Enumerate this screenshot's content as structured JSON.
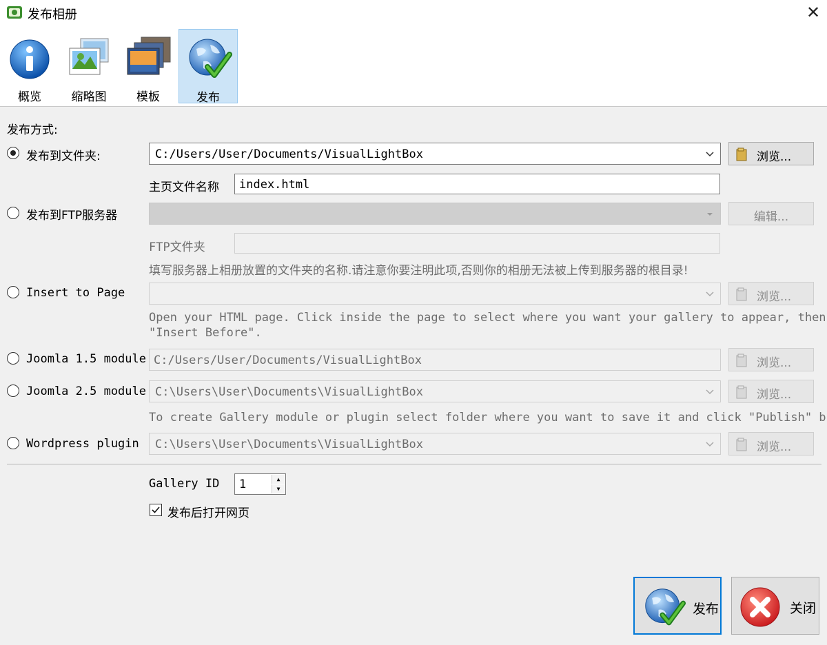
{
  "window": {
    "title": "发布相册",
    "close_glyph": "✕"
  },
  "tabs": [
    {
      "label": "概览",
      "icon": "info-icon"
    },
    {
      "label": "缩略图",
      "icon": "thumbnails-icon"
    },
    {
      "label": "模板",
      "icon": "templates-icon"
    },
    {
      "label": "发布",
      "icon": "globe-check-icon",
      "active": true
    }
  ],
  "publish": {
    "method_label": "发布方式:",
    "folder": {
      "label": "发布到文件夹:",
      "path": "C:/Users/User/Documents/VisualLightBox",
      "browse": "浏览...",
      "selected": true
    },
    "homepage": {
      "label": "主页文件名称",
      "value": "index.html"
    },
    "ftp": {
      "label": "发布到FTP服务器",
      "server": "",
      "edit": "编辑...",
      "folder_label": "FTP文件夹",
      "folder_value": "",
      "hint": "填写服务器上相册放置的文件夹的名称.请注意你要注明此项,否则你的相册无法被上传到服务器的根目录!"
    },
    "insert": {
      "label": "Insert to Page",
      "path": "",
      "browse": "浏览...",
      "hint_line1": "Open your HTML page. Click inside the page to select where you want your gallery to appear, then click",
      "hint_line2": "\"Insert Before\"."
    },
    "joomla15": {
      "label": "Joomla 1.5 module",
      "path": "C:/Users/User/Documents/VisualLightBox",
      "browse": "浏览..."
    },
    "joomla25": {
      "label": "Joomla 2.5 module",
      "path": "C:\\Users\\User\\Documents\\VisualLightBox",
      "browse": "浏览...",
      "hint": "To create Gallery module or plugin select folder where you want to save it and click \"Publish\" button."
    },
    "wordpress": {
      "label": "Wordpress plugin",
      "path": "C:\\Users\\User\\Documents\\VisualLightBox",
      "browse": "浏览..."
    }
  },
  "gallery_id": {
    "label": "Gallery ID",
    "value": "1"
  },
  "open_after": {
    "label": "发布后打开网页",
    "checked": true
  },
  "buttons": {
    "publish": "发布",
    "close": "关闭"
  }
}
